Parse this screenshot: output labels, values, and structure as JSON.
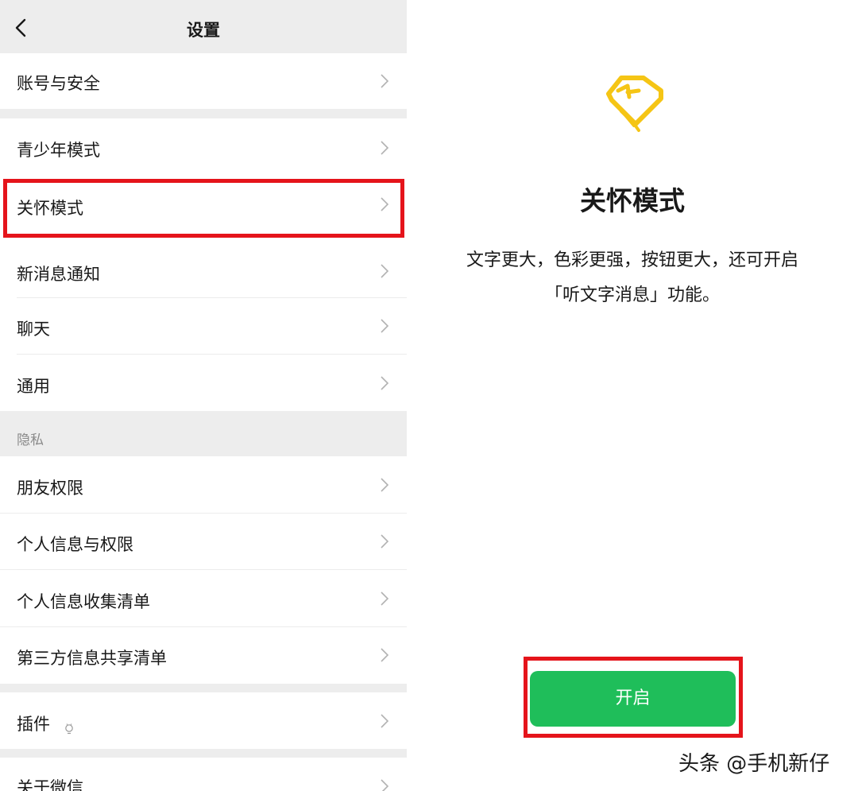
{
  "settings": {
    "title": "设置",
    "back_icon": "chevron-left-icon",
    "rows": {
      "account": "账号与安全",
      "teen": "青少年模式",
      "care": "关怀模式",
      "notifications": "新消息通知",
      "chat": "聊天",
      "general": "通用",
      "privacy_header": "隐私",
      "friends": "朋友权限",
      "personal_info": "个人信息与权限",
      "info_collection": "个人信息收集清单",
      "third_party": "第三方信息共享清单",
      "plugins": "插件",
      "about": "关于微信"
    }
  },
  "care_mode": {
    "icon": "heart-hand-icon",
    "title": "关怀模式",
    "desc_line1": "文字更大，色彩更强，按钮更大，还可开启",
    "desc_line2": "「听文字消息」功能。",
    "enable_button": "开启"
  },
  "watermark": "头条 @手机新仔",
  "colors": {
    "accent_green": "#1fbe5a",
    "highlight_red": "#e5141b",
    "logo_yellow": "#f5c515",
    "background_gray": "#ededed"
  }
}
